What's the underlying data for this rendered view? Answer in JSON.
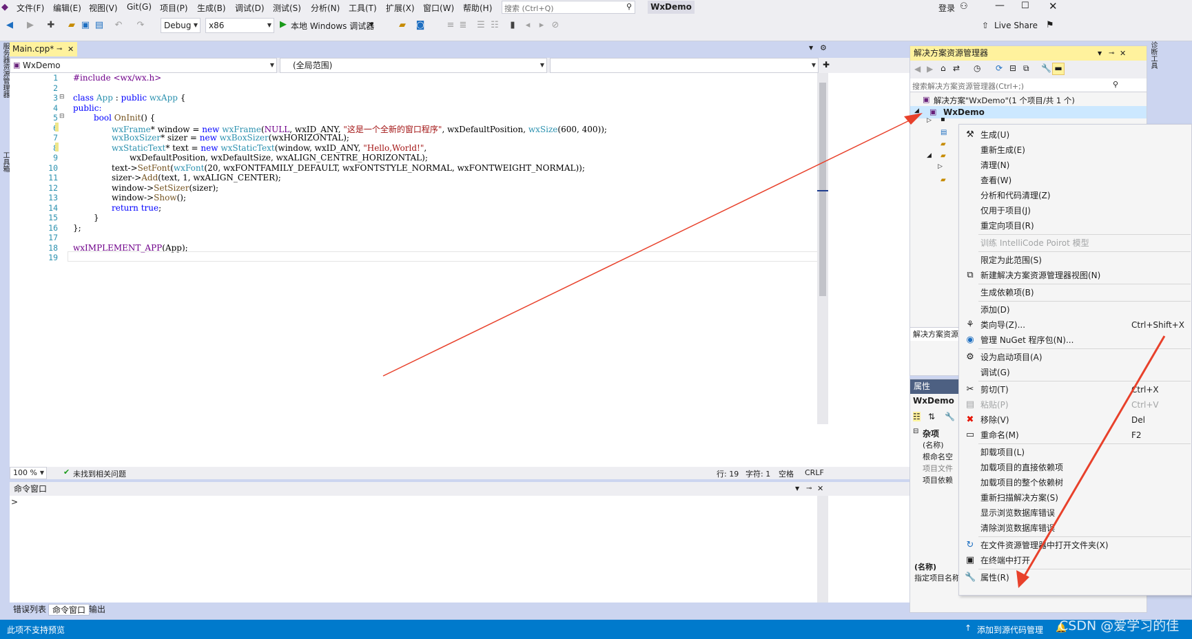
{
  "menu": {
    "items": [
      "文件(F)",
      "编辑(E)",
      "视图(V)",
      "Git(G)",
      "项目(P)",
      "生成(B)",
      "调试(D)",
      "测试(S)",
      "分析(N)",
      "工具(T)",
      "扩展(X)",
      "窗口(W)",
      "帮助(H)"
    ],
    "search_placeholder": "搜索 (Ctrl+Q)",
    "app_title": "WxDemo",
    "login": "登录"
  },
  "toolbar": {
    "config": "Debug",
    "platform": "x86",
    "run_label": "本地 Windows 调试器",
    "live_share": "Live Share"
  },
  "left_strip": {
    "tab1": "服务器资源管理器",
    "tab2": "工具箱"
  },
  "editor": {
    "tab_label": "Main.cpp*",
    "nav_project": "WxDemo",
    "nav_scope": "(全局范围)",
    "zoom": "100 %",
    "issues": "未找到相关问题",
    "line": "行: 19",
    "char": "字符: 1",
    "spaces": "空格",
    "eol": "CRLF",
    "line_numbers": [
      "1",
      "2",
      "3",
      "4",
      "5",
      "6",
      "7",
      "8",
      "9",
      "10",
      "11",
      "12",
      "13",
      "14",
      "15",
      "16",
      "17",
      "18",
      "19"
    ]
  },
  "code": {
    "l1": "#include <wx/wx.h>",
    "l3a": "class",
    "l3b": "App",
    "l3c": " : ",
    "l3d": "public",
    "l3e": "wxApp",
    "l3f": " {",
    "l4": "public:",
    "l5a": "bool",
    "l5b": "OnInit",
    "l5c": "() {",
    "l6a": "wxFrame",
    "l6b": "* window = ",
    "l6c": "new",
    "l6d": "wxFrame",
    "l6e": "(",
    "l6f": "NULL",
    "l6g": ", wxID_ANY, ",
    "l6h": "\"这是一个全新的窗口程序\"",
    "l6i": ", wxDefaultPosition, ",
    "l6j": "wxSize",
    "l6k": "(600, 400));",
    "l7a": "wxBoxSizer",
    "l7b": "* sizer = ",
    "l7c": "new",
    "l7d": "wxBoxSizer",
    "l7e": "(wxHORIZONTAL);",
    "l8a": "wxStaticText",
    "l8b": "* text = ",
    "l8c": "new",
    "l8d": "wxStaticText",
    "l8e": "(window, wxID_ANY, ",
    "l8f": "\"Hello,World!\"",
    "l8g": ",",
    "l9": "wxDefaultPosition, wxDefaultSize, wxALIGN_CENTRE_HORIZONTAL);",
    "l10a": "text->",
    "l10b": "SetFont",
    "l10c": "(",
    "l10d": "wxFont",
    "l10e": "(20, wxFONTFAMILY_DEFAULT, wxFONTSTYLE_NORMAL, wxFONTWEIGHT_NORMAL));",
    "l11a": "sizer->",
    "l11b": "Add",
    "l11c": "(text, 1, wxALIGN_CENTER);",
    "l12a": "window->",
    "l12b": "SetSizer",
    "l12c": "(sizer);",
    "l13a": "window->",
    "l13b": "Show",
    "l13c": "();",
    "l14a": "return",
    "l14b": "true",
    "l14c": ";",
    "l15": "}",
    "l16": "};",
    "l18a": "wxIMPLEMENT_APP",
    "l18b": "(App);"
  },
  "cmd": {
    "title": "命令窗口",
    "prompt": ">",
    "tabs": [
      "错误列表",
      "命令窗口",
      "输出"
    ]
  },
  "status": {
    "message": "此项不支持预览",
    "source_control": "添加到源代码管理"
  },
  "solution": {
    "title": "解决方案资源管理器",
    "search_placeholder": "搜索解决方案资源管理器(Ctrl+;)",
    "solution_node": "解决方案\"WxDemo\"(1 个项目/共 1 个)",
    "project_node": "WxDemo",
    "footer_tab": "解决方案资源"
  },
  "properties": {
    "title": "属性",
    "object": "WxDemo",
    "category": "杂项",
    "rows": [
      "(名称)",
      "根命名空",
      "项目文件",
      "项目依赖"
    ],
    "desc_title": "(名称)",
    "desc_text": "指定项目名称"
  },
  "right_strip": {
    "tab": "诊断工具"
  },
  "context_menu": {
    "items": [
      {
        "label": "生成(U)",
        "shortcut": "",
        "icon": "build-icon"
      },
      {
        "label": "重新生成(E)",
        "shortcut": "",
        "icon": ""
      },
      {
        "label": "清理(N)",
        "shortcut": "",
        "icon": ""
      },
      {
        "label": "查看(W)",
        "shortcut": "",
        "icon": ""
      },
      {
        "label": "分析和代码清理(Z)",
        "shortcut": "",
        "icon": ""
      },
      {
        "label": "仅用于项目(J)",
        "shortcut": "",
        "icon": ""
      },
      {
        "label": "重定向项目(R)",
        "shortcut": "",
        "icon": ""
      },
      {
        "label": "训练 IntelliCode Poirot 模型",
        "shortcut": "",
        "icon": "",
        "disabled": true
      },
      {
        "label": "限定为此范围(S)",
        "shortcut": "",
        "icon": ""
      },
      {
        "label": "新建解决方案资源管理器视图(N)",
        "shortcut": "",
        "icon": "new-view-icon"
      },
      {
        "label": "生成依赖项(B)",
        "shortcut": "",
        "icon": ""
      },
      {
        "label": "添加(D)",
        "shortcut": "",
        "icon": ""
      },
      {
        "label": "类向导(Z)...",
        "shortcut": "Ctrl+Shift+X",
        "icon": "class-wizard-icon"
      },
      {
        "label": "管理 NuGet 程序包(N)...",
        "shortcut": "",
        "icon": "nuget-icon"
      },
      {
        "label": "设为启动项目(A)",
        "shortcut": "",
        "icon": "gear-icon"
      },
      {
        "label": "调试(G)",
        "shortcut": "",
        "icon": ""
      },
      {
        "label": "剪切(T)",
        "shortcut": "Ctrl+X",
        "icon": "cut-icon"
      },
      {
        "label": "粘贴(P)",
        "shortcut": "Ctrl+V",
        "icon": "paste-icon",
        "disabled": true
      },
      {
        "label": "移除(V)",
        "shortcut": "Del",
        "icon": "remove-icon"
      },
      {
        "label": "重命名(M)",
        "shortcut": "F2",
        "icon": "rename-icon"
      },
      {
        "label": "卸载项目(L)",
        "shortcut": "",
        "icon": ""
      },
      {
        "label": "加载项目的直接依赖项",
        "shortcut": "",
        "icon": ""
      },
      {
        "label": "加载项目的整个依赖树",
        "shortcut": "",
        "icon": ""
      },
      {
        "label": "重新扫描解决方案(S)",
        "shortcut": "",
        "icon": ""
      },
      {
        "label": "显示浏览数据库错误",
        "shortcut": "",
        "icon": ""
      },
      {
        "label": "清除浏览数据库错误",
        "shortcut": "",
        "icon": ""
      },
      {
        "label": "在文件资源管理器中打开文件夹(X)",
        "shortcut": "",
        "icon": "open-folder-icon"
      },
      {
        "label": "在终端中打开",
        "shortcut": "",
        "icon": "terminal-icon"
      },
      {
        "label": "属性(R)",
        "shortcut": "",
        "icon": "wrench-icon"
      }
    ]
  },
  "watermark": "CSDN @爱学习的佳",
  "colors": {
    "accent": "#007acc",
    "arrow": "#e8412b",
    "selection": "#cce8ff"
  }
}
